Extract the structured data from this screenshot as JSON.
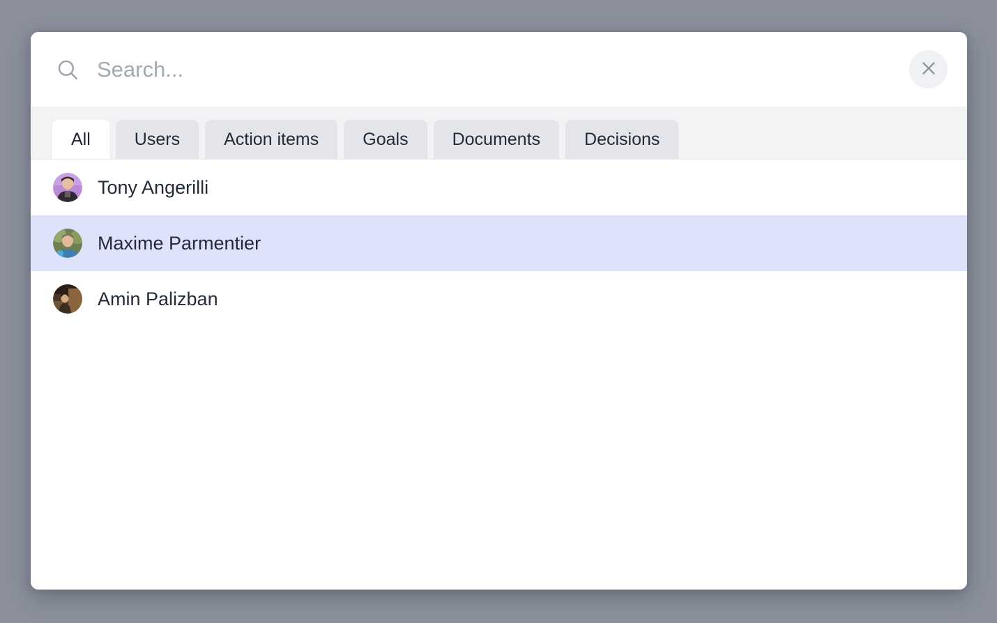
{
  "theme": {
    "backdrop_color": "#8b909c",
    "modal_background": "#ffffff",
    "tabstrip_background": "#f2f3f5",
    "tab_inactive_background": "#e3e5ea",
    "tab_active_background": "#ffffff",
    "row_selected_background": "#dfe2fb",
    "text_primary": "#232a38",
    "text_placeholder": "#a2a8b4",
    "icon_muted": "#9aa0ad",
    "close_button_background": "#f0f1f4"
  },
  "search": {
    "placeholder": "Search...",
    "value": "",
    "icon": "search-icon"
  },
  "close": {
    "label": "",
    "icon": "close-icon"
  },
  "tabs": [
    {
      "label": "All",
      "active": true
    },
    {
      "label": "Users",
      "active": false
    },
    {
      "label": "Action items",
      "active": false
    },
    {
      "label": "Goals",
      "active": false
    },
    {
      "label": "Documents",
      "active": false
    },
    {
      "label": "Decisions",
      "active": false
    }
  ],
  "results": [
    {
      "name": "Tony Angerilli",
      "selected": false,
      "avatar": {
        "type": "photo-portrait",
        "background": "#b98ad6",
        "accent": "#caa0e4",
        "skin": "#e8bfa2",
        "hair": "#3a2d2a",
        "clothing": "#2e2b33"
      }
    },
    {
      "name": "Maxime Parmentier",
      "selected": true,
      "avatar": {
        "type": "photo-portrait",
        "background": "#6f7f52",
        "accent": "#97a86c",
        "skin": "#e3bb9b",
        "hair": "#7c7364",
        "clothing": "#3e7fae"
      }
    },
    {
      "name": "Amin Palizban",
      "selected": false,
      "avatar": {
        "type": "photo-portrait",
        "background": "#4a3526",
        "accent": "#8d6440",
        "skin": "#d8ab85",
        "hair": "#2c1f17",
        "clothing": "#6d5236"
      }
    }
  ]
}
